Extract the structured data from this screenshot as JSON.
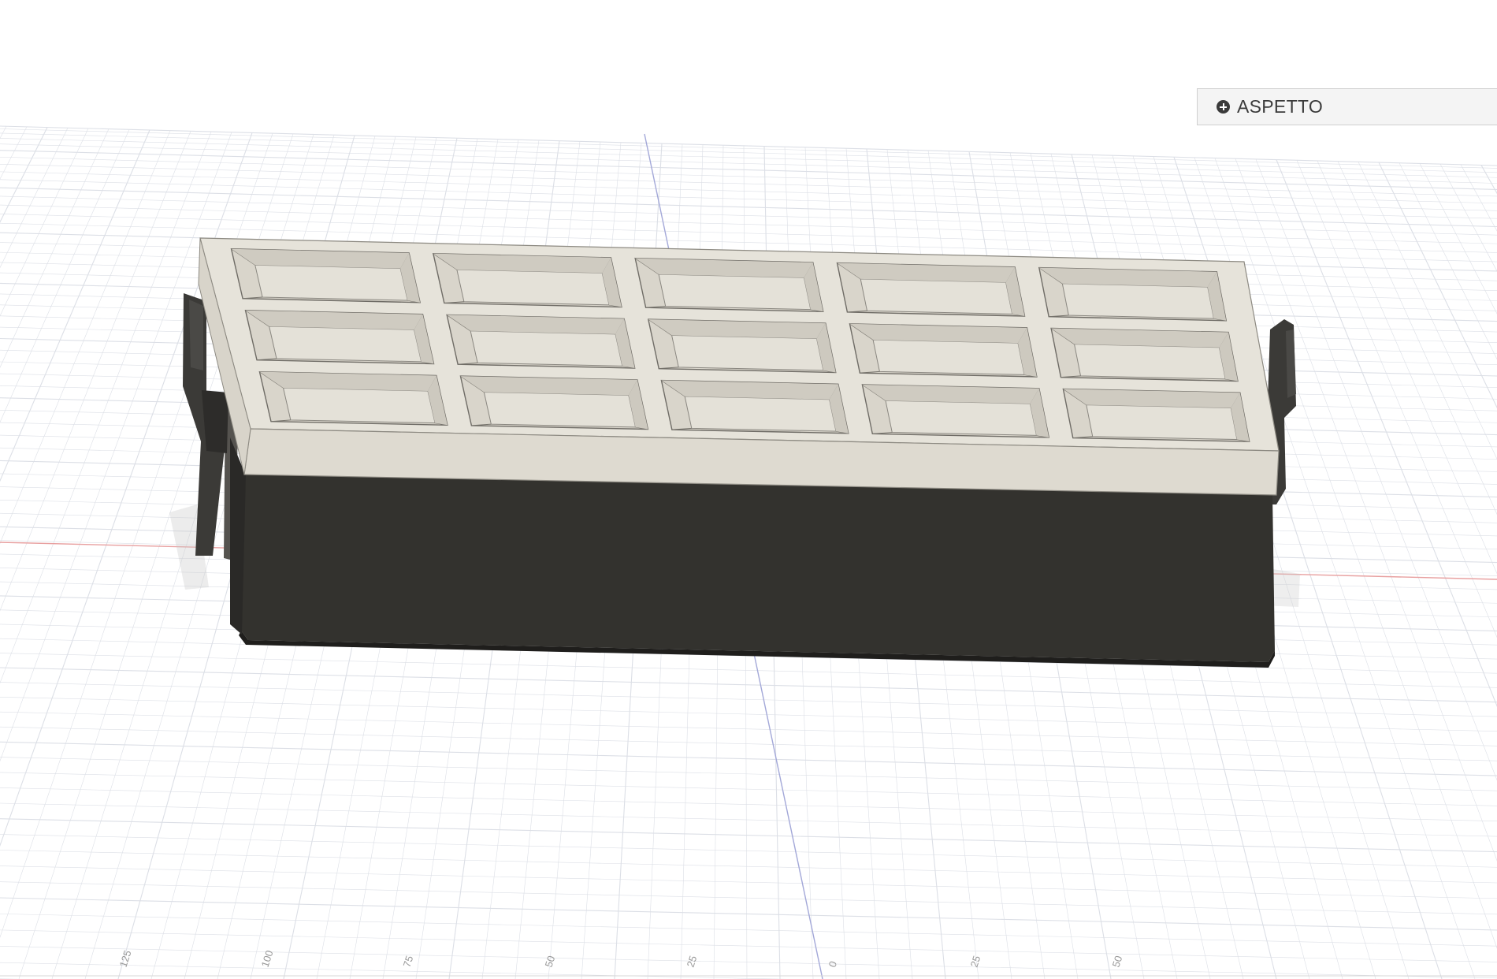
{
  "panel": {
    "aspetto_label": "ASPETTO",
    "icon": "plus-circle-icon"
  },
  "model": {
    "compartment_rows": 3,
    "compartment_columns": 5,
    "colors": {
      "tray": "#e6e3da",
      "tray_edge": "#8d8a82",
      "body": "#33322e",
      "clip": "#3b3a37",
      "grid_line": "#dcdfe6",
      "axis_red": "#e8a0a0",
      "axis_blue": "#a3a8d8"
    }
  },
  "ruler": {
    "ticks": [
      "125",
      "100",
      "75",
      "50",
      "25",
      "0",
      "25",
      "50"
    ]
  }
}
